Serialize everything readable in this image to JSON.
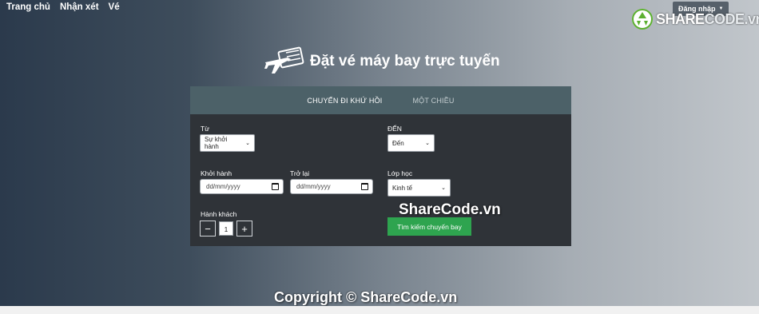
{
  "nav": {
    "items": [
      {
        "label": "Trang chủ"
      },
      {
        "label": "Nhận xét"
      },
      {
        "label": "Vé"
      }
    ],
    "login_label": "Đăng nhập"
  },
  "brand": {
    "text_a": "SHARE",
    "text_b": "CODE.vn"
  },
  "page_title": "Đặt vé máy bay trực tuyến",
  "tabs": [
    {
      "label": "CHUYẾN ĐI KHỨ HỒI",
      "active": true
    },
    {
      "label": "MỘT CHIỀU",
      "active": false
    }
  ],
  "form": {
    "from_label": "Từ",
    "from_value": "Sự khởi hành",
    "to_label": "ĐẾN",
    "to_value": "Đến",
    "depart_label": "Khởi hành",
    "depart_placeholder": "dd/mm/yyyy",
    "return_label": "Trở lại",
    "return_placeholder": "dd/mm/yyyy",
    "class_label": "Lớp học",
    "class_value": "Kinh tế",
    "passengers_label": "Hành khách",
    "passengers_value": "1",
    "minus_label": "−",
    "plus_label": "+",
    "search_label": "Tìm kiếm chuyến bay"
  },
  "watermark": {
    "mid": "ShareCode.vn",
    "bottom": "Copyright © ShareCode.vn"
  },
  "colors": {
    "card_bg": "#2f3338",
    "tabs_bg": "#4c6168",
    "accent_green": "#2ea44f"
  }
}
